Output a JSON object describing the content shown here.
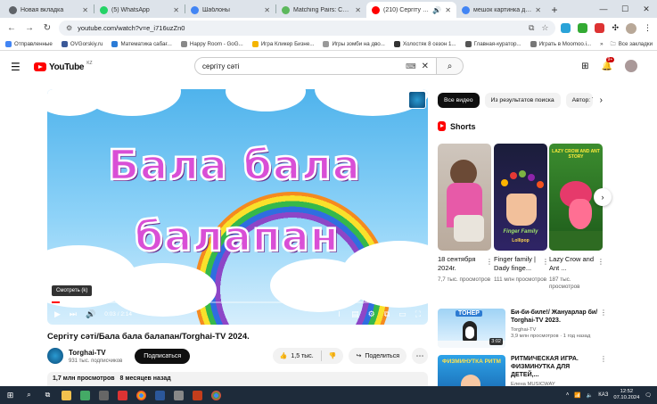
{
  "browser": {
    "tabs": [
      {
        "label": "Новая вкладка",
        "favicon_color": "#5f6368",
        "active": false
      },
      {
        "label": "(5) WhatsApp",
        "favicon_color": "#25d366",
        "active": false
      },
      {
        "label": "Шаблоны",
        "favicon_color": "#4285f4",
        "active": false
      },
      {
        "label": "Matching Pairs: Сайкестендір",
        "favicon_color": "#5cb85c",
        "active": false
      },
      {
        "label": "(210) Сергіту сәті/Бала б",
        "favicon_color": "#ff0000",
        "active": true
      },
      {
        "label": "мешок картинка для детей",
        "favicon_color": "#4285f4",
        "active": false
      }
    ],
    "new_tab_glyph": "+",
    "url": "youtube.com/watch?v=e_i716uzZn0",
    "bookmarks": [
      {
        "label": "Отправленные",
        "color": "#4285f4"
      },
      {
        "label": "OVGorskiy.ru",
        "color": "#3b5998"
      },
      {
        "label": "Математика сабағ...",
        "color": "#2b7bd6"
      },
      {
        "label": "Happy Room - GoG...",
        "color": "#888888"
      },
      {
        "label": "Игра Кликер Бизне...",
        "color": "#f4b400"
      },
      {
        "label": "Игры зомби на дво...",
        "color": "#999999"
      },
      {
        "label": "Холостяк 8 сезон 1...",
        "color": "#333333"
      },
      {
        "label": "Главная-куратор...",
        "color": "#555555"
      },
      {
        "label": "Играть в Moomoo.i...",
        "color": "#777777"
      }
    ],
    "all_bookmarks_label": "Все закладки"
  },
  "youtube": {
    "logo_text": "YouTube",
    "region": "KZ",
    "search_value": "сергіту сәті",
    "notifications_count": "9+",
    "video": {
      "overlay_line1": "Бала бала",
      "overlay_line2": "балапан",
      "tooltip": "Смотреть (k)",
      "time": "0:03 / 2:14",
      "progress": 0.022,
      "title": "Сергіту сәті/Бала бала балапан/Torghai-TV 2024.",
      "channel": "Torghai-TV",
      "subscribers": "931 тыс. подписчиков",
      "subscribe_label": "Подписаться",
      "likes": "1,5 тыс.",
      "share_label": "Поделиться",
      "views": "1,7 млн просмотров",
      "published": "8 месяцев назад"
    },
    "chips": [
      "Все видео",
      "Из результатов поиска",
      "Автор: T"
    ],
    "shorts_heading": "Shorts",
    "shorts": [
      {
        "title": "18 сентября 2024г.",
        "views": "7,7 тыс. просмотров"
      },
      {
        "title": "Finger family | Dady finge...",
        "views": "111 млн просмотров",
        "thumb_label": "Finger Family",
        "thumb_sub": "Lollipop"
      },
      {
        "title": "Lazy Crow and Ant ...",
        "views": "187 тыс. просмотров",
        "thumb_label": "LAZY CROW AND ANT STORY"
      }
    ],
    "recommendations": [
      {
        "title": "Би-би-биле!/ Жануарлар би/ Torghai-TV 2023.",
        "channel": "Torghai-TV",
        "stats": "3,9 млн просмотров · 1 год назад",
        "duration": "3:02",
        "thumb_label": "ТОНЕР"
      },
      {
        "title": "РИТМИЧЕСКАЯ ИГРА. ФИЗМИНУТКА ДЛЯ ДЕТЕЙ,...",
        "channel": "Елена MUSICWAY",
        "stats": "",
        "duration": "",
        "thumb_label": "ФИЗМИНУТКА РИТМ"
      }
    ]
  },
  "taskbar": {
    "lang": "КАЗ",
    "time": "12:52",
    "date": "07.10.2024"
  }
}
